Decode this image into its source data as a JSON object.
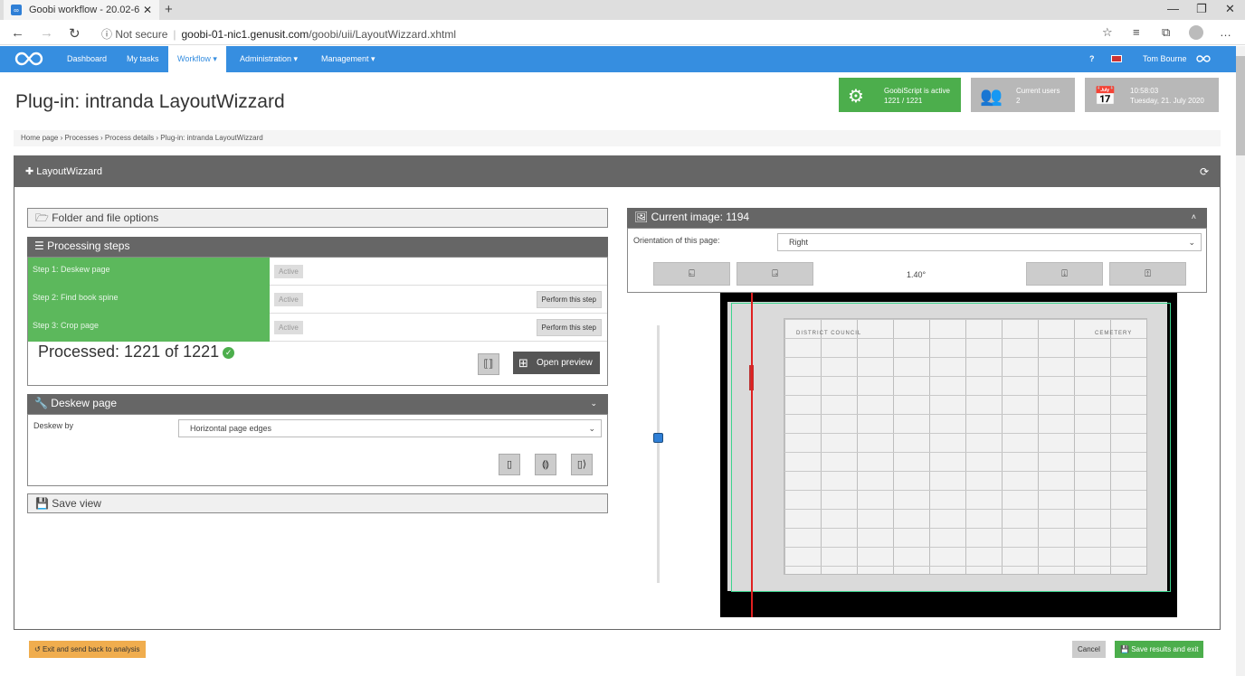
{
  "browser": {
    "tab_title": "Goobi workflow - 20.02-6",
    "url_prefix": "Not secure",
    "url_host": "goobi-01-nic1.genusit.com",
    "url_path": "/goobi/uii/LayoutWizzard.xhtml"
  },
  "nav": {
    "items": [
      "Dashboard",
      "My tasks",
      "Workflow ▾",
      "Administration ▾",
      "Management ▾"
    ],
    "help": "?",
    "user": "Tom Bourne"
  },
  "page": {
    "title": "Plug-in: intranda LayoutWizzard"
  },
  "info": {
    "goobiscript_line1": "GoobiScript is active",
    "goobiscript_line2": "1221 / 1221",
    "users_line1": "Current users",
    "users_line2": "2",
    "time_line1": "10:58:03",
    "time_line2": "Tuesday, 21. July 2020"
  },
  "breadcrumb": "Home page › Processes › Process details › Plug-in: intranda LayoutWizzard",
  "main": {
    "title": "LayoutWizzard"
  },
  "folder": {
    "title": "Folder and file options"
  },
  "processing": {
    "title": "Processing steps",
    "steps": [
      {
        "name": "Step 1: Deskew page",
        "status": "Active",
        "action": ""
      },
      {
        "name": "Step 2: Find book spine",
        "status": "Active",
        "action": "Perform this step"
      },
      {
        "name": "Step 3: Crop page",
        "status": "Active",
        "action": "Perform this step"
      }
    ],
    "processed": "Processed: 1221 of 1221",
    "preview_label": "Open preview"
  },
  "deskew": {
    "title": "Deskew page",
    "by_label": "Deskew by",
    "by_value": "Horizontal page edges"
  },
  "save_view": {
    "title": "Save view"
  },
  "image": {
    "title": "Current image: 1194",
    "orientation_label": "Orientation of this page:",
    "orientation_value": "Right",
    "angle": "1.40°",
    "sheet_text": "DISTRICT COUNCIL",
    "sheet_text2": "CEMETERY"
  },
  "footer": {
    "exit": "Exit and send back to analysis",
    "cancel": "Cancel",
    "save": "Save results and exit"
  }
}
